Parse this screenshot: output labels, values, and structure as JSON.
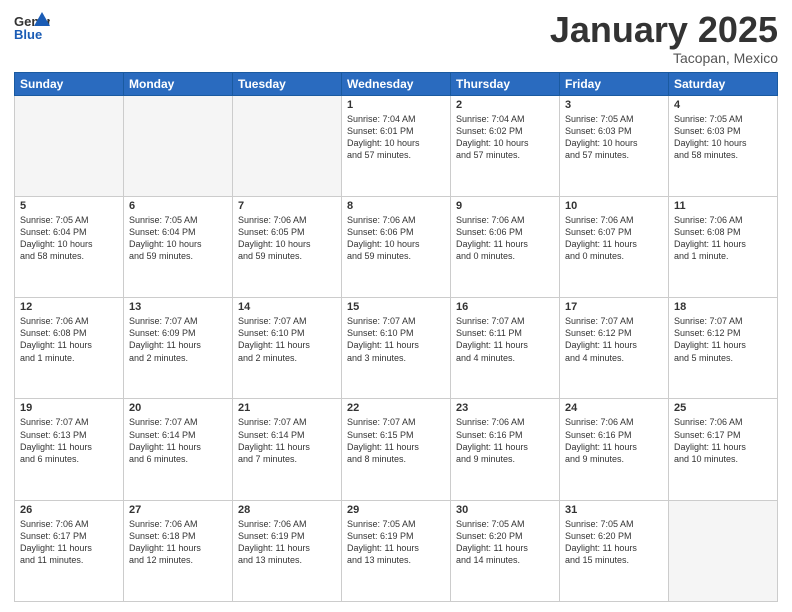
{
  "header": {
    "logo_general": "General",
    "logo_blue": "Blue",
    "month": "January 2025",
    "location": "Tacopan, Mexico"
  },
  "weekdays": [
    "Sunday",
    "Monday",
    "Tuesday",
    "Wednesday",
    "Thursday",
    "Friday",
    "Saturday"
  ],
  "weeks": [
    [
      {
        "day": "",
        "text": ""
      },
      {
        "day": "",
        "text": ""
      },
      {
        "day": "",
        "text": ""
      },
      {
        "day": "1",
        "text": "Sunrise: 7:04 AM\nSunset: 6:01 PM\nDaylight: 10 hours\nand 57 minutes."
      },
      {
        "day": "2",
        "text": "Sunrise: 7:04 AM\nSunset: 6:02 PM\nDaylight: 10 hours\nand 57 minutes."
      },
      {
        "day": "3",
        "text": "Sunrise: 7:05 AM\nSunset: 6:03 PM\nDaylight: 10 hours\nand 57 minutes."
      },
      {
        "day": "4",
        "text": "Sunrise: 7:05 AM\nSunset: 6:03 PM\nDaylight: 10 hours\nand 58 minutes."
      }
    ],
    [
      {
        "day": "5",
        "text": "Sunrise: 7:05 AM\nSunset: 6:04 PM\nDaylight: 10 hours\nand 58 minutes."
      },
      {
        "day": "6",
        "text": "Sunrise: 7:05 AM\nSunset: 6:04 PM\nDaylight: 10 hours\nand 59 minutes."
      },
      {
        "day": "7",
        "text": "Sunrise: 7:06 AM\nSunset: 6:05 PM\nDaylight: 10 hours\nand 59 minutes."
      },
      {
        "day": "8",
        "text": "Sunrise: 7:06 AM\nSunset: 6:06 PM\nDaylight: 10 hours\nand 59 minutes."
      },
      {
        "day": "9",
        "text": "Sunrise: 7:06 AM\nSunset: 6:06 PM\nDaylight: 11 hours\nand 0 minutes."
      },
      {
        "day": "10",
        "text": "Sunrise: 7:06 AM\nSunset: 6:07 PM\nDaylight: 11 hours\nand 0 minutes."
      },
      {
        "day": "11",
        "text": "Sunrise: 7:06 AM\nSunset: 6:08 PM\nDaylight: 11 hours\nand 1 minute."
      }
    ],
    [
      {
        "day": "12",
        "text": "Sunrise: 7:06 AM\nSunset: 6:08 PM\nDaylight: 11 hours\nand 1 minute."
      },
      {
        "day": "13",
        "text": "Sunrise: 7:07 AM\nSunset: 6:09 PM\nDaylight: 11 hours\nand 2 minutes."
      },
      {
        "day": "14",
        "text": "Sunrise: 7:07 AM\nSunset: 6:10 PM\nDaylight: 11 hours\nand 2 minutes."
      },
      {
        "day": "15",
        "text": "Sunrise: 7:07 AM\nSunset: 6:10 PM\nDaylight: 11 hours\nand 3 minutes."
      },
      {
        "day": "16",
        "text": "Sunrise: 7:07 AM\nSunset: 6:11 PM\nDaylight: 11 hours\nand 4 minutes."
      },
      {
        "day": "17",
        "text": "Sunrise: 7:07 AM\nSunset: 6:12 PM\nDaylight: 11 hours\nand 4 minutes."
      },
      {
        "day": "18",
        "text": "Sunrise: 7:07 AM\nSunset: 6:12 PM\nDaylight: 11 hours\nand 5 minutes."
      }
    ],
    [
      {
        "day": "19",
        "text": "Sunrise: 7:07 AM\nSunset: 6:13 PM\nDaylight: 11 hours\nand 6 minutes."
      },
      {
        "day": "20",
        "text": "Sunrise: 7:07 AM\nSunset: 6:14 PM\nDaylight: 11 hours\nand 6 minutes."
      },
      {
        "day": "21",
        "text": "Sunrise: 7:07 AM\nSunset: 6:14 PM\nDaylight: 11 hours\nand 7 minutes."
      },
      {
        "day": "22",
        "text": "Sunrise: 7:07 AM\nSunset: 6:15 PM\nDaylight: 11 hours\nand 8 minutes."
      },
      {
        "day": "23",
        "text": "Sunrise: 7:06 AM\nSunset: 6:16 PM\nDaylight: 11 hours\nand 9 minutes."
      },
      {
        "day": "24",
        "text": "Sunrise: 7:06 AM\nSunset: 6:16 PM\nDaylight: 11 hours\nand 9 minutes."
      },
      {
        "day": "25",
        "text": "Sunrise: 7:06 AM\nSunset: 6:17 PM\nDaylight: 11 hours\nand 10 minutes."
      }
    ],
    [
      {
        "day": "26",
        "text": "Sunrise: 7:06 AM\nSunset: 6:17 PM\nDaylight: 11 hours\nand 11 minutes."
      },
      {
        "day": "27",
        "text": "Sunrise: 7:06 AM\nSunset: 6:18 PM\nDaylight: 11 hours\nand 12 minutes."
      },
      {
        "day": "28",
        "text": "Sunrise: 7:06 AM\nSunset: 6:19 PM\nDaylight: 11 hours\nand 13 minutes."
      },
      {
        "day": "29",
        "text": "Sunrise: 7:05 AM\nSunset: 6:19 PM\nDaylight: 11 hours\nand 13 minutes."
      },
      {
        "day": "30",
        "text": "Sunrise: 7:05 AM\nSunset: 6:20 PM\nDaylight: 11 hours\nand 14 minutes."
      },
      {
        "day": "31",
        "text": "Sunrise: 7:05 AM\nSunset: 6:20 PM\nDaylight: 11 hours\nand 15 minutes."
      },
      {
        "day": "",
        "text": ""
      }
    ]
  ]
}
